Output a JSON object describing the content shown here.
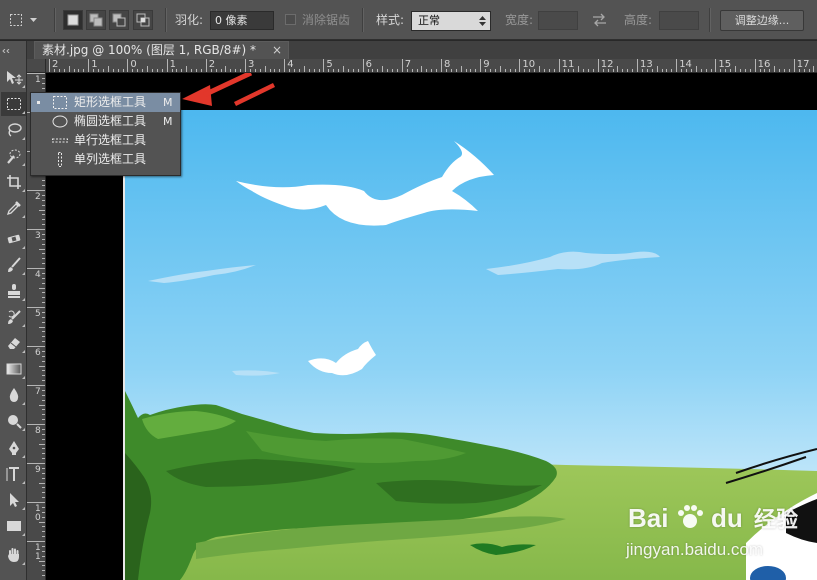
{
  "option_bar": {
    "feather_label": "羽化:",
    "feather_value": "0 像素",
    "anti_alias_label": "消除锯齿",
    "style_label": "样式:",
    "style_value": "正常",
    "width_label": "宽度:",
    "width_value": "",
    "height_label": "高度:",
    "height_value": "",
    "refine_edge_label": "调整边缘..."
  },
  "document_tab": {
    "title": "素材.jpg @ 100% (图层 1, RGB/8#) *",
    "close": "×"
  },
  "ruler": {
    "horizontal_labels": [
      "2",
      "1",
      "0",
      "1",
      "2",
      "3",
      "4",
      "5",
      "6",
      "7",
      "8",
      "9",
      "10",
      "11",
      "12",
      "13",
      "14",
      "15",
      "16",
      "17"
    ],
    "vertical_labels": [
      {
        "lines": [
          "1"
        ]
      },
      {
        "lines": [
          "0"
        ]
      },
      {
        "lines": [
          "1"
        ]
      },
      {
        "lines": [
          "2"
        ]
      },
      {
        "lines": [
          "3"
        ]
      },
      {
        "lines": [
          "4"
        ]
      },
      {
        "lines": [
          "5"
        ]
      },
      {
        "lines": [
          "6"
        ]
      },
      {
        "lines": [
          "7"
        ]
      },
      {
        "lines": [
          "8"
        ]
      },
      {
        "lines": [
          "9"
        ]
      },
      {
        "lines": [
          "1",
          "0"
        ]
      },
      {
        "lines": [
          "1",
          "1"
        ]
      }
    ]
  },
  "flyout": {
    "items": [
      {
        "label": "矩形选框工具",
        "shortcut": "M",
        "icon": "rect-marquee-icon",
        "active": true
      },
      {
        "label": "椭圆选框工具",
        "shortcut": "M",
        "icon": "ellipse-marquee-icon",
        "active": false
      },
      {
        "label": "单行选框工具",
        "shortcut": "",
        "icon": "single-row-marquee-icon",
        "active": false
      },
      {
        "label": "单列选框工具",
        "shortcut": "",
        "icon": "single-column-marquee-icon",
        "active": false
      }
    ]
  },
  "watermark": {
    "brand_prefix": "Bai",
    "brand_suffix": "du",
    "brand_cn": "经验",
    "url": "jingyan.baidu.com"
  },
  "colors": {
    "ui_panel": "#535353",
    "canvas_bg": "#000000",
    "sky_top": "#4db8ef",
    "grass": "#3b8a2c",
    "arrow": "#e2372b",
    "highlight": "#7a8da3"
  }
}
